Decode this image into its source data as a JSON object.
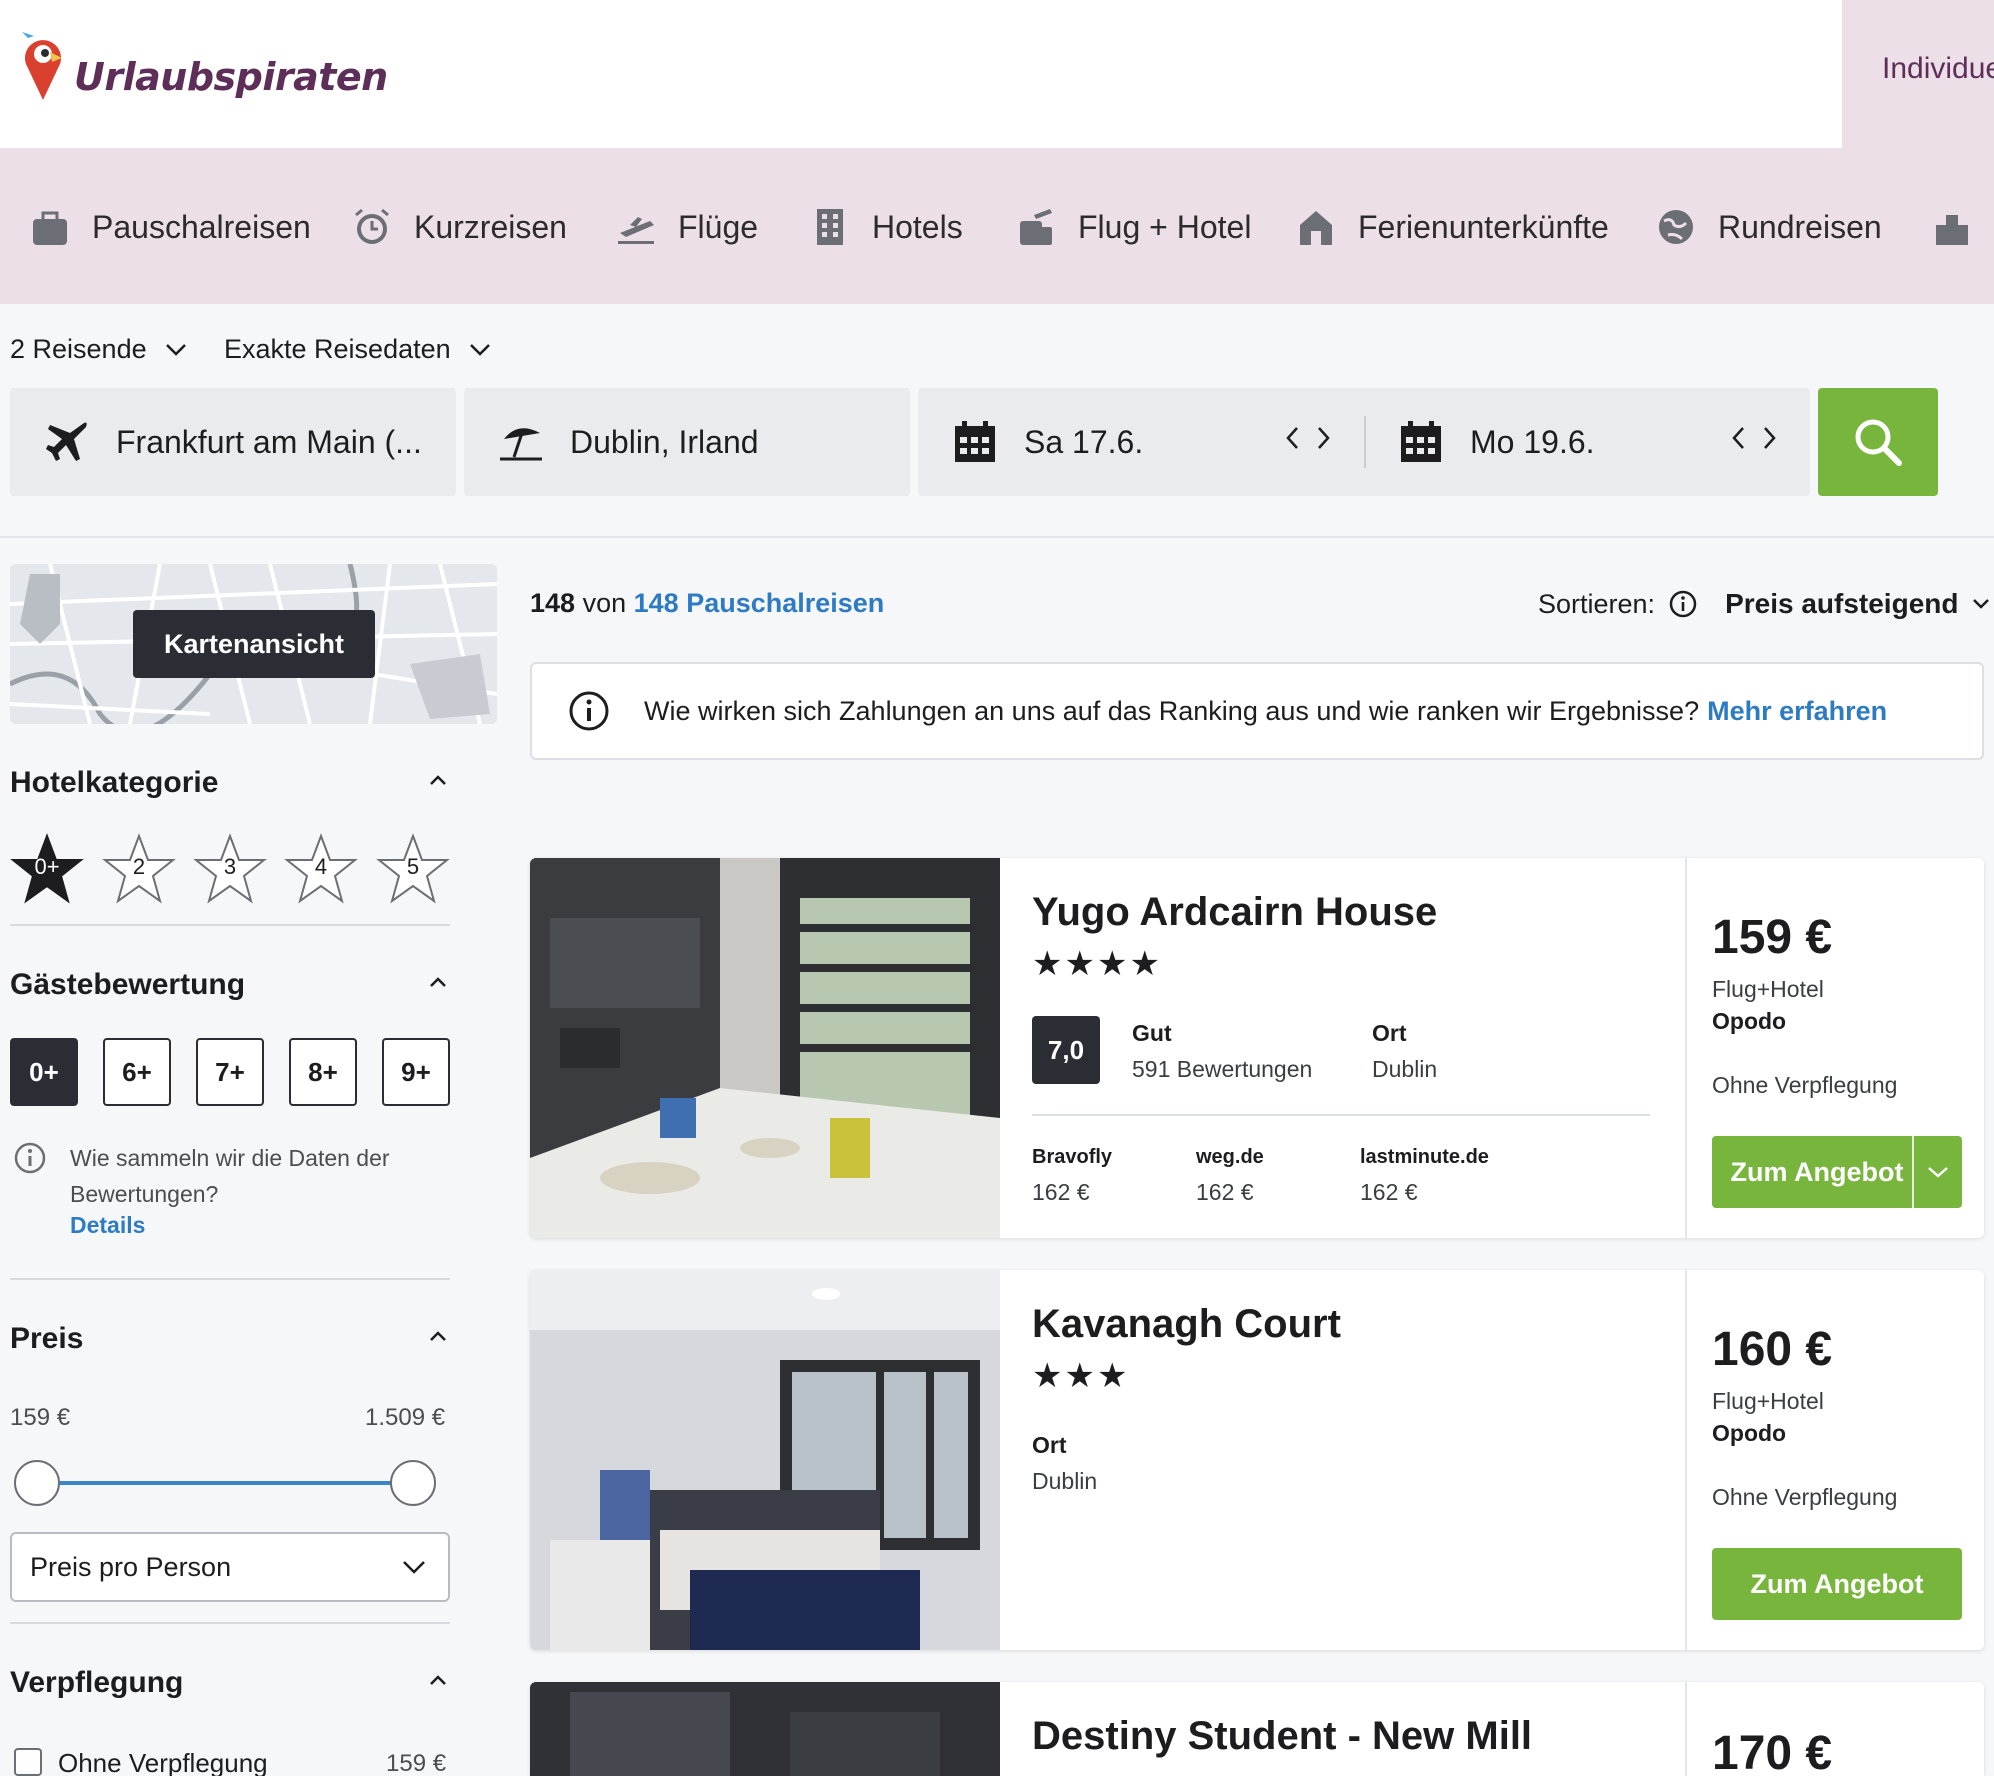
{
  "brand": {
    "name": "Urlaubspiraten",
    "color": "#5c2e58",
    "accent": "#78b53c",
    "link_color": "#2e7bc4"
  },
  "header": {
    "right_tab": "Individue"
  },
  "nav": {
    "items": [
      {
        "label": "Pauschalreisen",
        "icon": "suitcase-icon"
      },
      {
        "label": "Kurzreisen",
        "icon": "alarm-clock-icon"
      },
      {
        "label": "Flüge",
        "icon": "airplane-takeoff-icon"
      },
      {
        "label": "Hotels",
        "icon": "building-icon"
      },
      {
        "label": "Flug + Hotel",
        "icon": "luggage-icon"
      },
      {
        "label": "Ferienunterkünfte",
        "icon": "house-icon"
      },
      {
        "label": "Rundreisen",
        "icon": "globe-icon"
      }
    ]
  },
  "search": {
    "travellers": "2 Reisende",
    "date_mode": "Exakte Reisedaten",
    "origin": "Frankfurt am Main (...",
    "destination": "Dublin, Irland",
    "date_from": "Sa 17.6.",
    "date_to": "Mo 19.6."
  },
  "sidebar": {
    "map_button": "Kartenansicht",
    "hotel_category": {
      "title": "Hotelkategorie",
      "options": [
        "0+",
        "2",
        "3",
        "4",
        "5"
      ],
      "selected": "0+"
    },
    "guest_rating": {
      "title": "Gästebewertung",
      "options": [
        "0+",
        "6+",
        "7+",
        "8+",
        "9+"
      ],
      "selected": "0+",
      "note": "Wie sammeln wir die Daten der Bewertungen?",
      "link": "Details"
    },
    "price": {
      "title": "Preis",
      "min": "159 €",
      "max": "1.509 €",
      "select": "Preis pro Person"
    },
    "board": {
      "title": "Verpflegung",
      "option": "Ohne Verpflegung",
      "option_price": "159 €"
    }
  },
  "results": {
    "count": "148",
    "of": "von",
    "total_link": "148 Pauschalreisen",
    "sort_label": "Sortieren:",
    "sort_value": "Preis aufsteigend",
    "notice": "Wie wirken sich Zahlungen an uns auf das Ranking aus und wie ranken wir Ergebnisse?",
    "notice_link": "Mehr erfahren",
    "hotels": [
      {
        "name": "Yugo Ardcairn House",
        "stars": "★★★★",
        "score": "7,0",
        "rating_label": "Gut",
        "review_count": "591 Bewertungen",
        "location_label": "Ort",
        "location": "Dublin",
        "providers": [
          {
            "name": "Bravofly",
            "price": "162 €"
          },
          {
            "name": "weg.de",
            "price": "162 €"
          },
          {
            "name": "lastminute.de",
            "price": "162 €"
          }
        ],
        "price": "159 €",
        "price_type": "Flug+Hotel",
        "provider": "Opodo",
        "board": "Ohne Verpflegung",
        "button": "Zum Angebot"
      },
      {
        "name": "Kavanagh Court",
        "stars": "★★★",
        "location_label": "Ort",
        "location": "Dublin",
        "price": "160 €",
        "price_type": "Flug+Hotel",
        "provider": "Opodo",
        "board": "Ohne Verpflegung",
        "button": "Zum Angebot"
      },
      {
        "name": "Destiny Student - New Mill",
        "price": "170 €"
      }
    ]
  }
}
